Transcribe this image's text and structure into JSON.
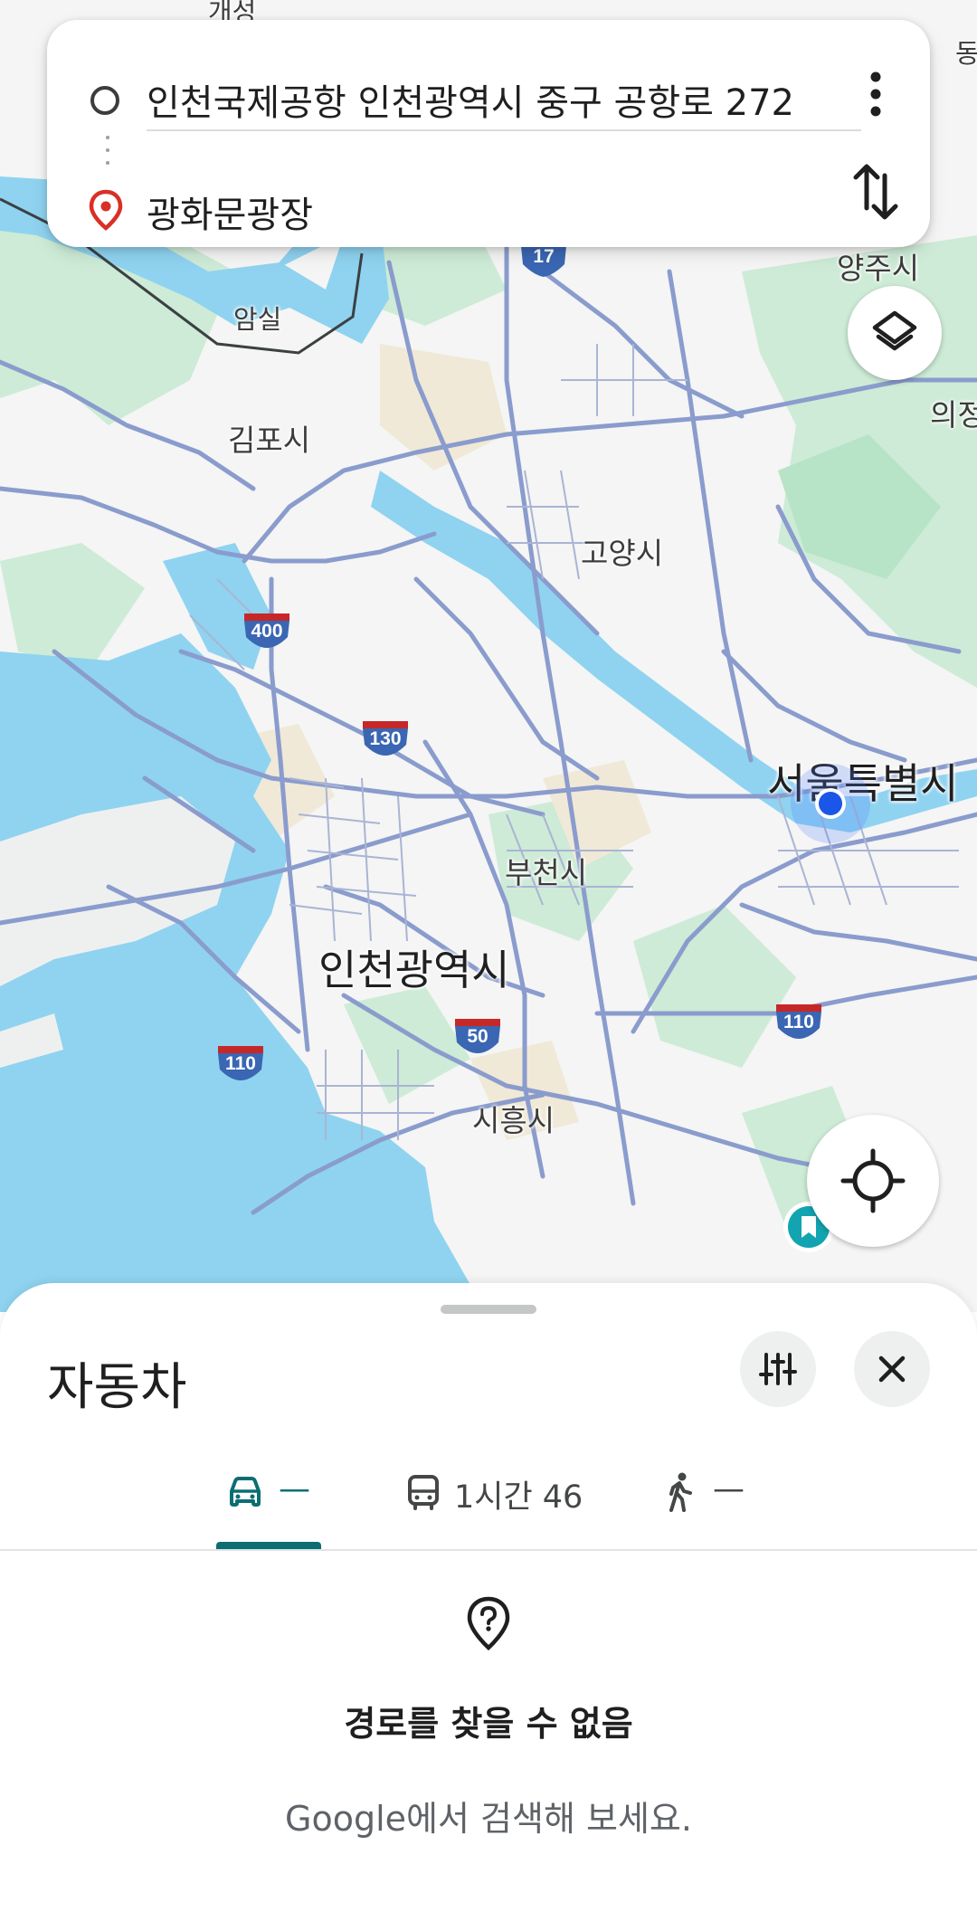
{
  "route": {
    "origin": "인천국제공항 인천광역시 중구 공항로 272",
    "destination": "광화문광장"
  },
  "map": {
    "labels": {
      "gaeseong": "개성",
      "dong": "동",
      "yangju": "양주시",
      "uijeong": "의정",
      "amsil": "암실",
      "gimpo": "김포시",
      "goyang": "고양시",
      "seoul": "서울특별시",
      "bucheon": "부천시",
      "incheon": "인천광역시",
      "siheung": "시흥시"
    },
    "shields": {
      "r17": "17",
      "r400": "400",
      "r130": "130",
      "r110_east": "110",
      "r50": "50",
      "r110_west": "110"
    },
    "colors": {
      "water": "#8fd3f0",
      "park": "#c9ecd5",
      "land": "#f4f5f4",
      "road": "#8a9ccd",
      "shield_blue": "#3a66b3",
      "shield_red": "#c62828"
    }
  },
  "sheet": {
    "title": "자동차",
    "tabs": [
      {
        "mode": "drive",
        "label": "—",
        "icon": "car-icon",
        "selected": true
      },
      {
        "mode": "transit",
        "label": "1시간 46",
        "icon": "bus-icon",
        "selected": false
      },
      {
        "mode": "walk",
        "label": "—",
        "icon": "walk-icon",
        "selected": false
      }
    ],
    "empty_state": {
      "icon": "place-question-icon",
      "title": "경로를 찾을 수 없음",
      "subtitle": "Google에서 검색해 보세요."
    }
  },
  "colors": {
    "accent": "#0b6e72",
    "destination_pin": "#d93025",
    "location_dot": "#1a56e8"
  }
}
